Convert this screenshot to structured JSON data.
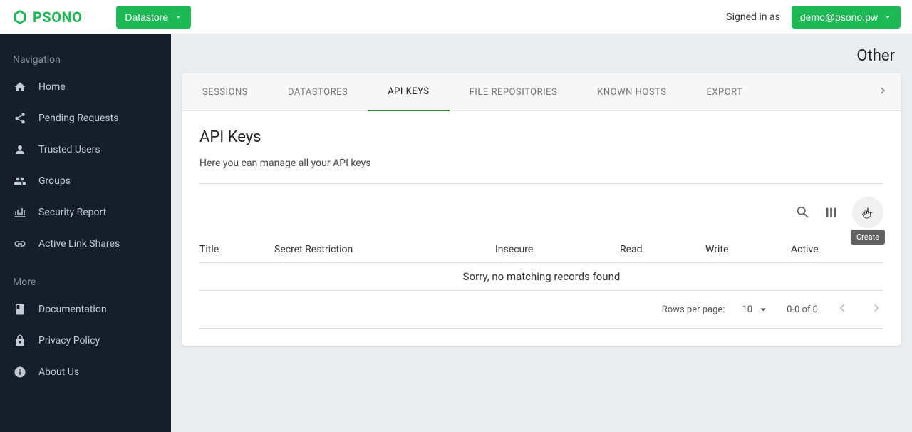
{
  "header": {
    "logo_text": "PSONO",
    "datastore_label": "Datastore",
    "signed_in_label": "Signed in as",
    "user_email": "demo@psono.pw"
  },
  "sidebar": {
    "section1_label": "Navigation",
    "items1": [
      {
        "label": "Home",
        "icon": "home"
      },
      {
        "label": "Pending Requests",
        "icon": "share"
      },
      {
        "label": "Trusted Users",
        "icon": "person"
      },
      {
        "label": "Groups",
        "icon": "people"
      },
      {
        "label": "Security Report",
        "icon": "report"
      },
      {
        "label": "Active Link Shares",
        "icon": "link"
      }
    ],
    "section2_label": "More",
    "items2": [
      {
        "label": "Documentation",
        "icon": "book"
      },
      {
        "label": "Privacy Policy",
        "icon": "lock"
      },
      {
        "label": "About Us",
        "icon": "info"
      }
    ]
  },
  "page": {
    "title": "Other"
  },
  "tabs": [
    {
      "label": "SESSIONS",
      "active": false
    },
    {
      "label": "DATASTORES",
      "active": false
    },
    {
      "label": "API KEYS",
      "active": true
    },
    {
      "label": "FILE REPOSITORIES",
      "active": false
    },
    {
      "label": "KNOWN HOSTS",
      "active": false
    },
    {
      "label": "EXPORT",
      "active": false
    }
  ],
  "section": {
    "title": "API Keys",
    "description": "Here you can manage all your API keys"
  },
  "toolbar": {
    "create_tooltip": "Create"
  },
  "table": {
    "columns": [
      "Title",
      "Secret Restriction",
      "Insecure",
      "Read",
      "Write",
      "Active"
    ],
    "empty_message": "Sorry, no matching records found"
  },
  "pagination": {
    "rows_label": "Rows per page:",
    "rows_value": "10",
    "range": "0-0 of 0"
  }
}
